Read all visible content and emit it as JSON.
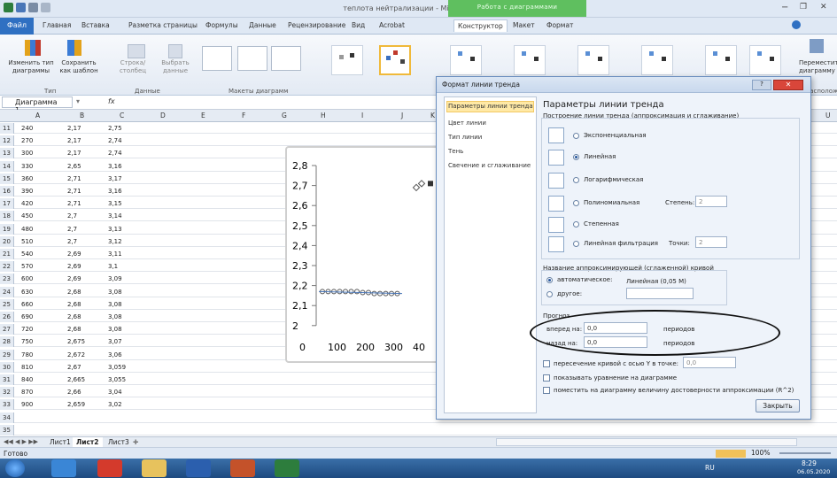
{
  "window": {
    "title": "теплота нейтрализации - Microsoft Excel",
    "context_group": "Работа с диаграммами"
  },
  "tabs": [
    "Главная",
    "Вставка",
    "Разметка страницы",
    "Формулы",
    "Данные",
    "Рецензирование",
    "Вид",
    "Acrobat",
    "Конструктор",
    "Макет",
    "Формат"
  ],
  "file_tab": "Файл",
  "ribbon": {
    "change_type": "Изменить тип диаграммы",
    "save_template": "Сохранить как шаблон",
    "group_type": "Тип",
    "row_col": "Строка/столбец",
    "select_data": "Выбрать данные",
    "group_data": "Данные",
    "group_layouts": "Макеты диаграмм",
    "move_chart": "Переместить диаграмму",
    "group_location": "Расположение"
  },
  "namebox": "Диаграмма 1",
  "fx": "fx",
  "columns": [
    "A",
    "B",
    "C",
    "D",
    "E",
    "F",
    "G",
    "H",
    "I",
    "J",
    "K",
    "U"
  ],
  "rows": [
    {
      "n": "11",
      "a": "240",
      "b": "2,17",
      "c": "2,75"
    },
    {
      "n": "12",
      "a": "270",
      "b": "2,17",
      "c": "2,74"
    },
    {
      "n": "13",
      "a": "300",
      "b": "2,17",
      "c": "2,74"
    },
    {
      "n": "14",
      "a": "330",
      "b": "2,65",
      "c": "3,16"
    },
    {
      "n": "15",
      "a": "360",
      "b": "2,71",
      "c": "3,17"
    },
    {
      "n": "16",
      "a": "390",
      "b": "2,71",
      "c": "3,16"
    },
    {
      "n": "17",
      "a": "420",
      "b": "2,71",
      "c": "3,15"
    },
    {
      "n": "18",
      "a": "450",
      "b": "2,7",
      "c": "3,14"
    },
    {
      "n": "19",
      "a": "480",
      "b": "2,7",
      "c": "3,13"
    },
    {
      "n": "20",
      "a": "510",
      "b": "2,7",
      "c": "3,12"
    },
    {
      "n": "21",
      "a": "540",
      "b": "2,69",
      "c": "3,11"
    },
    {
      "n": "22",
      "a": "570",
      "b": "2,69",
      "c": "3,1"
    },
    {
      "n": "23",
      "a": "600",
      "b": "2,69",
      "c": "3,09"
    },
    {
      "n": "24",
      "a": "630",
      "b": "2,68",
      "c": "3,08"
    },
    {
      "n": "25",
      "a": "660",
      "b": "2,68",
      "c": "3,08"
    },
    {
      "n": "26",
      "a": "690",
      "b": "2,68",
      "c": "3,08"
    },
    {
      "n": "27",
      "a": "720",
      "b": "2,68",
      "c": "3,08"
    },
    {
      "n": "28",
      "a": "750",
      "b": "2,675",
      "c": "3,07"
    },
    {
      "n": "29",
      "a": "780",
      "b": "2,672",
      "c": "3,06"
    },
    {
      "n": "30",
      "a": "810",
      "b": "2,67",
      "c": "3,059"
    },
    {
      "n": "31",
      "a": "840",
      "b": "2,665",
      "c": "3,055"
    },
    {
      "n": "32",
      "a": "870",
      "b": "2,66",
      "c": "3,04"
    },
    {
      "n": "33",
      "a": "900",
      "b": "2,659",
      "c": "3,02"
    },
    {
      "n": "34",
      "a": "",
      "b": "",
      "c": ""
    },
    {
      "n": "35",
      "a": "",
      "b": "",
      "c": ""
    }
  ],
  "chart": {
    "y_ticks": [
      "2,8",
      "2,7",
      "2,6",
      "2,5",
      "2,4",
      "2,3",
      "2,2",
      "2,1",
      "2"
    ],
    "x_ticks": [
      "0",
      "100",
      "200",
      "300",
      "40"
    ]
  },
  "sheet_tabs": [
    "Лист1",
    "Лист2",
    "Лист3"
  ],
  "status": {
    "ready": "Готово",
    "zoom": "100%"
  },
  "taskbar": {
    "lang": "RU",
    "time": "8:29",
    "date": "06.05.2020"
  },
  "dialog": {
    "title": "Формат линии тренда",
    "nav": [
      "Параметры линии тренда",
      "Цвет линии",
      "Тип линии",
      "Тень",
      "Свечение и сглаживание"
    ],
    "heading": "Параметры линии тренда",
    "group_build": "Построение линии тренда (аппроксимация и сглаживание)",
    "types": [
      "Экспоненциальная",
      "Линейная",
      "Логарифмическая",
      "Полиномиальная",
      "Степенная",
      "Линейная фильтрация"
    ],
    "degree_label": "Степень:",
    "degree_value": "2",
    "points_label": "Точки:",
    "points_value": "2",
    "group_name": "Название аппроксимирующей (сглаженной) кривой",
    "name_auto": "автоматическое:",
    "name_auto_value": "Линейная (0,05 М)",
    "name_other": "другое:",
    "group_forecast": "Прогноз",
    "forward_label": "вперед на:",
    "forward_value": "0,0",
    "periods1": "периодов",
    "back_label": "назад на:",
    "back_value": "0,0",
    "periods2": "периодов",
    "intercept_label": "пересечение кривой с осью Y в точке:",
    "intercept_value": "0,0",
    "show_eq": "показывать уравнение на диаграмме",
    "show_r2": "поместить на диаграмму величину достоверности аппроксимации (R^2)",
    "close": "Закрыть"
  }
}
